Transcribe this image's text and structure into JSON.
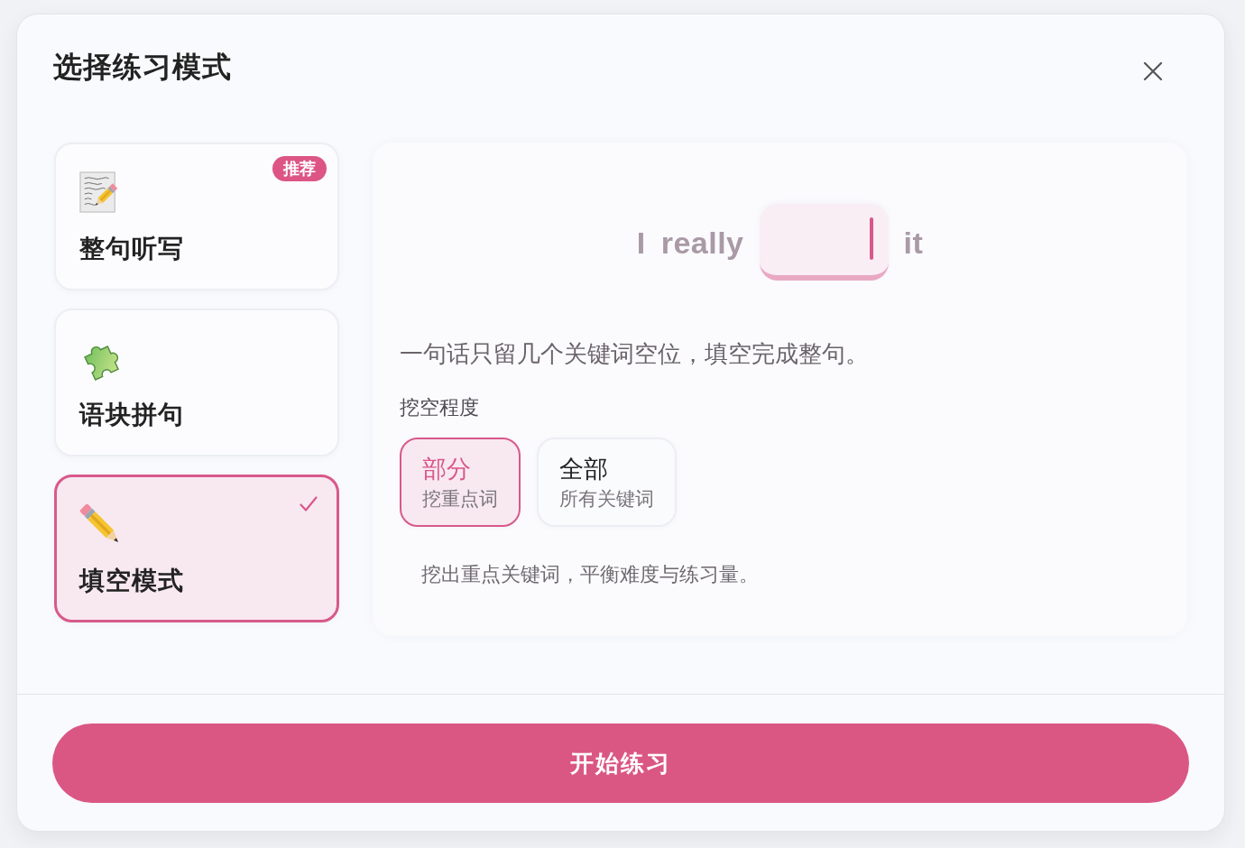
{
  "dialog": {
    "title": "选择练习模式"
  },
  "modes": [
    {
      "label": "整句听写",
      "badge": "推荐",
      "selected": false
    },
    {
      "label": "语块拼句",
      "selected": false
    },
    {
      "label": "填空模式",
      "selected": true
    }
  ],
  "preview": {
    "tokens": [
      {
        "kind": "word",
        "text": "I"
      },
      {
        "kind": "word",
        "text": "really"
      },
      {
        "kind": "blank",
        "focused": true
      },
      {
        "kind": "word",
        "text": "it"
      }
    ],
    "description": "一句话只留几个关键词空位，填空完成整句。"
  },
  "difficulty": {
    "label": "挖空程度",
    "options": [
      {
        "title": "部分",
        "subtitle": "挖重点词",
        "selected": true
      },
      {
        "title": "全部",
        "subtitle": "所有关键词",
        "selected": false
      }
    ],
    "explanation": "挖出重点关键词，平衡难度与练习量。"
  },
  "start_button": "开始练习"
}
